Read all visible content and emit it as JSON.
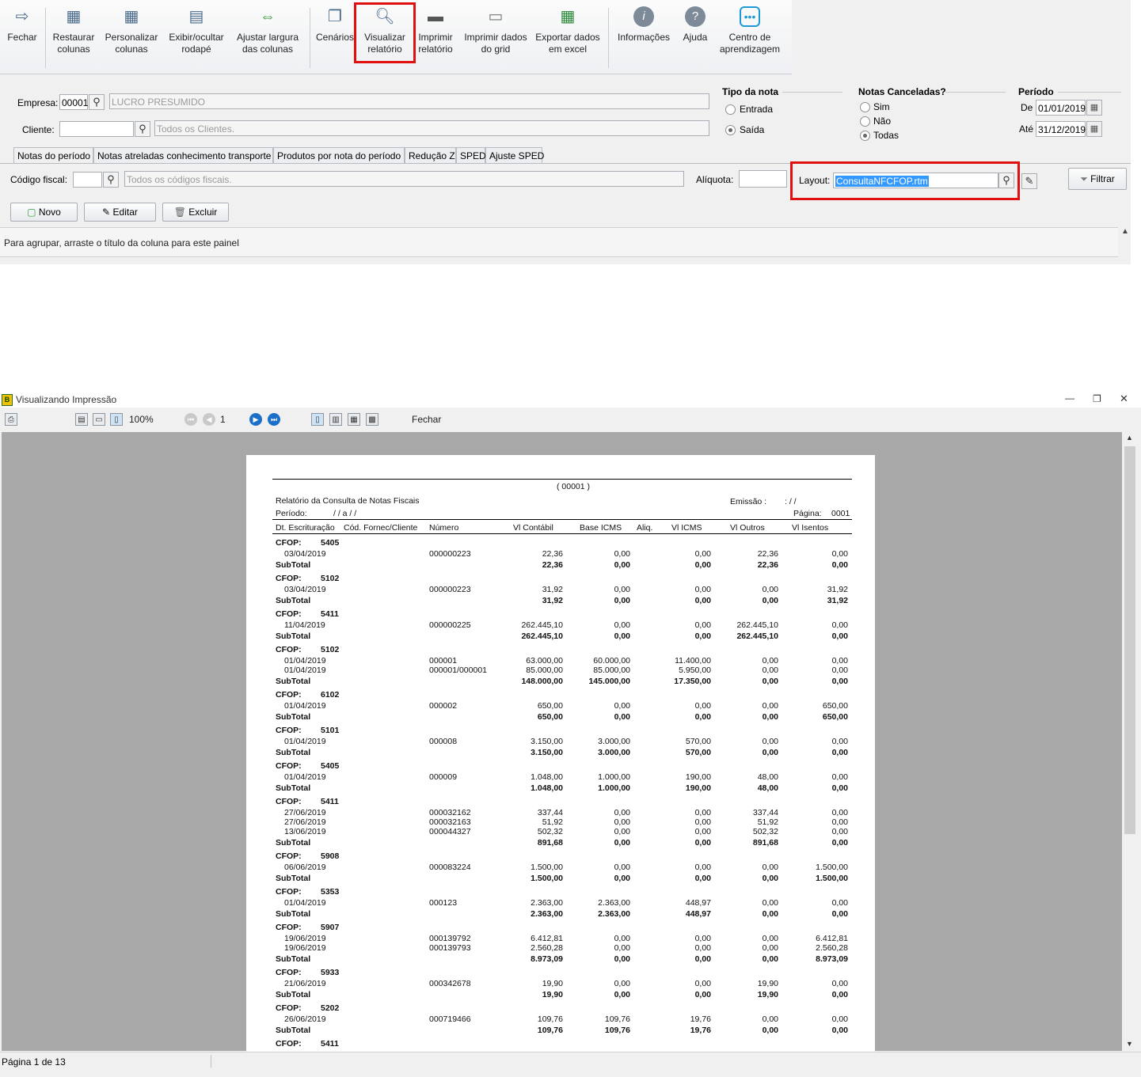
{
  "toolbar": {
    "buttons": [
      {
        "label": "Fechar",
        "icon": "exit-icon"
      },
      {
        "label": "Restaurar colunas",
        "icon": "restore-columns-icon"
      },
      {
        "label": "Personalizar colunas",
        "icon": "customize-columns-icon"
      },
      {
        "label": "Exibir/ocultar rodapé",
        "icon": "footer-icon"
      },
      {
        "label": "Ajustar largura das colunas",
        "icon": "fit-width-icon"
      },
      {
        "label": "Cenários",
        "icon": "scenarios-icon"
      },
      {
        "label": "Visualizar relatório",
        "icon": "preview-report-icon"
      },
      {
        "label": "Imprimir relatório",
        "icon": "printer-icon"
      },
      {
        "label": "Imprimir dados do grid",
        "icon": "print-grid-icon"
      },
      {
        "label": "Exportar dados em excel",
        "icon": "excel-icon"
      },
      {
        "label": "Informações",
        "icon": "info-icon"
      },
      {
        "label": "Ajuda",
        "icon": "help-icon"
      },
      {
        "label": "Centro de aprendizagem",
        "icon": "learning-center-icon"
      }
    ]
  },
  "filters": {
    "empresa_label": "Empresa:",
    "empresa_code": "00001",
    "empresa_name": "LUCRO PRESUMIDO",
    "cliente_label": "Cliente:",
    "cliente_placeholder": "Todos os Clientes.",
    "tipo_nota_title": "Tipo da nota",
    "tipo_entrada": "Entrada",
    "tipo_saida": "Saída",
    "canceladas_title": "Notas Canceladas?",
    "canc_sim": "Sim",
    "canc_nao": "Não",
    "canc_todas": "Todas",
    "periodo_title": "Período",
    "de_label": "De",
    "de_value": "01/01/2019",
    "ate_label": "Até",
    "ate_value": "31/12/2019"
  },
  "tabs": [
    "Notas do período",
    "Notas atreladas conhecimento transporte",
    "Produtos por nota do período",
    "Redução Z",
    "SPED",
    "Ajuste SPED"
  ],
  "panel": {
    "codigo_fiscal_label": "Código fiscal:",
    "codigo_fiscal_placeholder": "Todos os códigos fiscais.",
    "aliquota_label": "Alíquota:",
    "layout_label": "Layout:",
    "layout_value": "ConsultaNFCFOP.rtm",
    "filtrar_label": "Filtrar",
    "novo_label": "Novo",
    "editar_label": "Editar",
    "excluir_label": "Excluir",
    "group_hint": "Para agrupar, arraste o título da coluna para este painel"
  },
  "preview": {
    "title": "Visualizando Impressão",
    "zoom": "100%",
    "page_input": "1",
    "fechar_label": "Fechar",
    "status": "Página 1 de 13"
  },
  "report": {
    "company": "( 00001 )",
    "title": "Relatório da Consulta de Notas Fiscais",
    "emissao": "Emissão :",
    "emissao_value": ":          /   /",
    "periodo": "Período:",
    "periodo_value": "/    /         a     /    /",
    "pagina_label": "Página:",
    "pagina_value": "0001",
    "columns": [
      "Dt. Escrituração",
      "Cód. Fornec/Cliente",
      "Número",
      "Vl Contábil",
      "Base ICMS",
      "Aliq.",
      "Vl ICMS",
      "Vl Outros",
      "Vl Isentos"
    ],
    "cfop_label": "CFOP:",
    "subtotal_label": "SubTotal",
    "groups": [
      {
        "cfop": "5405",
        "rows": [
          [
            "03/04/2019",
            "000000223",
            "22,36",
            "0,00",
            "0,00",
            "22,36",
            "0,00"
          ]
        ],
        "total": [
          "22,36",
          "0,00",
          "0,00",
          "22,36",
          "0,00"
        ]
      },
      {
        "cfop": "5102",
        "rows": [
          [
            "03/04/2019",
            "000000223",
            "31,92",
            "0,00",
            "0,00",
            "0,00",
            "31,92"
          ]
        ],
        "total": [
          "31,92",
          "0,00",
          "0,00",
          "0,00",
          "31,92"
        ]
      },
      {
        "cfop": "5411",
        "rows": [
          [
            "11/04/2019",
            "000000225",
            "262.445,10",
            "0,00",
            "0,00",
            "262.445,10",
            "0,00"
          ]
        ],
        "total": [
          "262.445,10",
          "0,00",
          "0,00",
          "262.445,10",
          "0,00"
        ]
      },
      {
        "cfop": "5102",
        "rows": [
          [
            "01/04/2019",
            "000001",
            "63.000,00",
            "60.000,00",
            "11.400,00",
            "0,00",
            "0,00"
          ],
          [
            "01/04/2019",
            "000001/000001",
            "85.000,00",
            "85.000,00",
            "5.950,00",
            "0,00",
            "0,00"
          ]
        ],
        "total": [
          "148.000,00",
          "145.000,00",
          "17.350,00",
          "0,00",
          "0,00"
        ]
      },
      {
        "cfop": "6102",
        "rows": [
          [
            "01/04/2019",
            "000002",
            "650,00",
            "0,00",
            "0,00",
            "0,00",
            "650,00"
          ]
        ],
        "total": [
          "650,00",
          "0,00",
          "0,00",
          "0,00",
          "650,00"
        ]
      },
      {
        "cfop": "5101",
        "rows": [
          [
            "01/04/2019",
            "000008",
            "3.150,00",
            "3.000,00",
            "570,00",
            "0,00",
            "0,00"
          ]
        ],
        "total": [
          "3.150,00",
          "3.000,00",
          "570,00",
          "0,00",
          "0,00"
        ]
      },
      {
        "cfop": "5405",
        "rows": [
          [
            "01/04/2019",
            "000009",
            "1.048,00",
            "1.000,00",
            "190,00",
            "48,00",
            "0,00"
          ]
        ],
        "total": [
          "1.048,00",
          "1.000,00",
          "190,00",
          "48,00",
          "0,00"
        ]
      },
      {
        "cfop": "5411",
        "rows": [
          [
            "27/06/2019",
            "000032162",
            "337,44",
            "0,00",
            "0,00",
            "337,44",
            "0,00"
          ],
          [
            "27/06/2019",
            "000032163",
            "51,92",
            "0,00",
            "0,00",
            "51,92",
            "0,00"
          ],
          [
            "13/06/2019",
            "000044327",
            "502,32",
            "0,00",
            "0,00",
            "502,32",
            "0,00"
          ]
        ],
        "total": [
          "891,68",
          "0,00",
          "0,00",
          "891,68",
          "0,00"
        ]
      },
      {
        "cfop": "5908",
        "rows": [
          [
            "06/06/2019",
            "000083224",
            "1.500,00",
            "0,00",
            "0,00",
            "0,00",
            "1.500,00"
          ]
        ],
        "total": [
          "1.500,00",
          "0,00",
          "0,00",
          "0,00",
          "1.500,00"
        ]
      },
      {
        "cfop": "5353",
        "rows": [
          [
            "01/04/2019",
            "000123",
            "2.363,00",
            "2.363,00",
            "448,97",
            "0,00",
            "0,00"
          ]
        ],
        "total": [
          "2.363,00",
          "2.363,00",
          "448,97",
          "0,00",
          "0,00"
        ]
      },
      {
        "cfop": "5907",
        "rows": [
          [
            "19/06/2019",
            "000139792",
            "6.412,81",
            "0,00",
            "0,00",
            "0,00",
            "6.412,81"
          ],
          [
            "19/06/2019",
            "000139793",
            "2.560,28",
            "0,00",
            "0,00",
            "0,00",
            "2.560,28"
          ]
        ],
        "total": [
          "8.973,09",
          "0,00",
          "0,00",
          "0,00",
          "8.973,09"
        ]
      },
      {
        "cfop": "5933",
        "rows": [
          [
            "21/06/2019",
            "000342678",
            "19,90",
            "0,00",
            "0,00",
            "19,90",
            "0,00"
          ]
        ],
        "total": [
          "19,90",
          "0,00",
          "0,00",
          "19,90",
          "0,00"
        ]
      },
      {
        "cfop": "5202",
        "rows": [
          [
            "26/06/2019",
            "000719466",
            "109,76",
            "109,76",
            "19,76",
            "0,00",
            "0,00"
          ]
        ],
        "total": [
          "109,76",
          "109,76",
          "19,76",
          "0,00",
          "0,00"
        ]
      },
      {
        "cfop": "5411",
        "rows": [],
        "total": null
      }
    ]
  }
}
